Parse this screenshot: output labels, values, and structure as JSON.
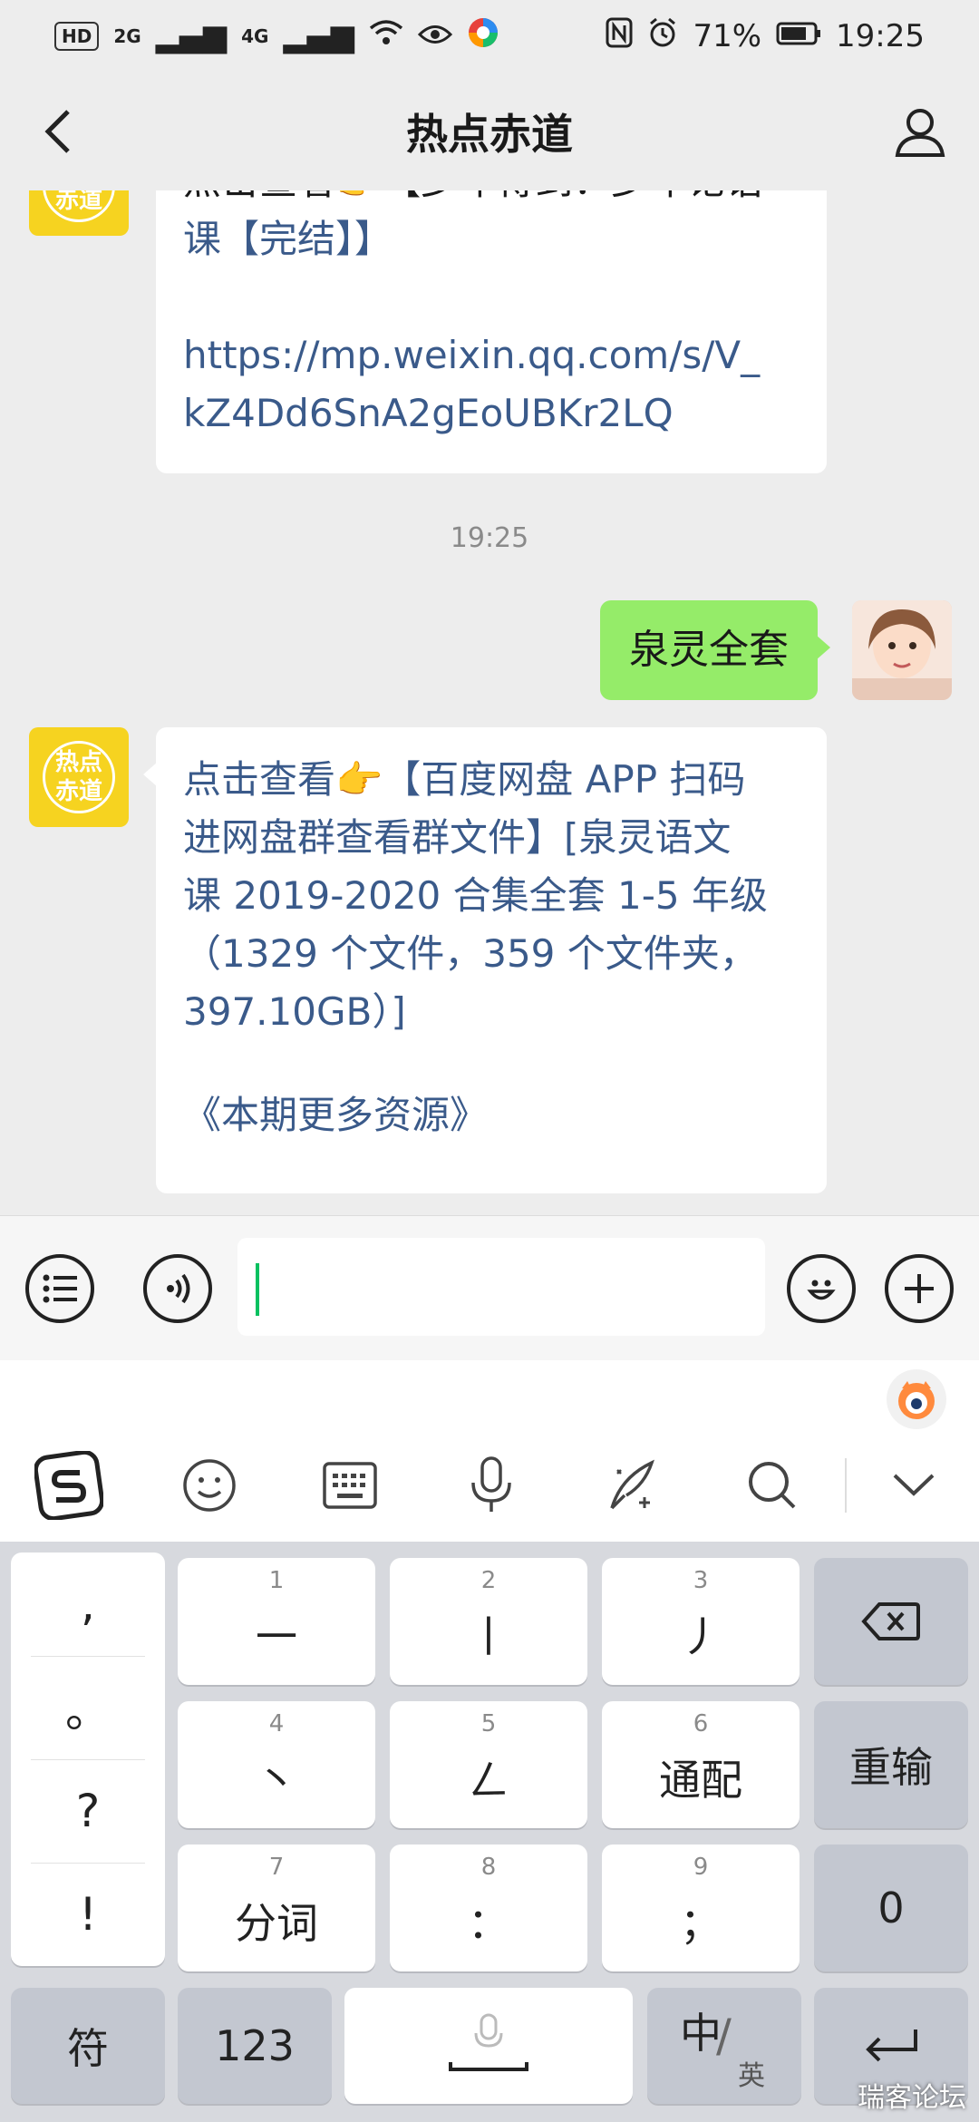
{
  "status_bar": {
    "hd_badge": "HD",
    "net_1": "2G",
    "net_2": "4G",
    "battery": "71%",
    "time": "19:25"
  },
  "nav": {
    "title": "热点赤道"
  },
  "brand_avatar": {
    "line1": "热点",
    "line2": "赤道"
  },
  "messages": {
    "msg1_line1": "点击查看👉【少年得到：少年论语",
    "msg1_line2": "课【完结】】",
    "msg1_link_1": "https://mp.weixin.qq.com/s/V_",
    "msg1_link_2": "kZ4Dd6SnA2gEoUBKr2LQ",
    "timestamp": "19:25",
    "me_text": "泉灵全套",
    "msg2_line1": "点击查看👉【百度网盘 APP 扫码",
    "msg2_line2": "进网盘群查看群文件】[泉灵语文",
    "msg2_line3": "课 2019-2020 合集全套 1-5 年级",
    "msg2_line4": "（1329 个文件，359 个文件夹，",
    "msg2_line5": "397.10GB）]",
    "msg2_more": "《本期更多资源》"
  },
  "keyboard": {
    "punct": [
      ",",
      "。",
      "?",
      "!"
    ],
    "keys_row1": [
      {
        "num": "1",
        "label": "一"
      },
      {
        "num": "2",
        "label": "丨"
      },
      {
        "num": "3",
        "label": "丿"
      }
    ],
    "keys_row2": [
      {
        "num": "4",
        "label": "丶"
      },
      {
        "num": "5",
        "label": "ㄥ"
      },
      {
        "num": "6",
        "label": "通配"
      }
    ],
    "keys_row3": [
      {
        "num": "7",
        "label": "分词"
      },
      {
        "num": "8",
        "label": "："
      },
      {
        "num": "9",
        "label": "；"
      }
    ],
    "reenter": "重输",
    "zero": "0",
    "symbol": "符",
    "numeric": "123",
    "lang_main": "中",
    "lang_sub": "英"
  },
  "watermark": "瑞客论坛",
  "colors": {
    "accent": "#07c160",
    "my_bubble": "#95ec69",
    "link": "#3a5a8a",
    "brand_yellow": "#f6d320"
  }
}
